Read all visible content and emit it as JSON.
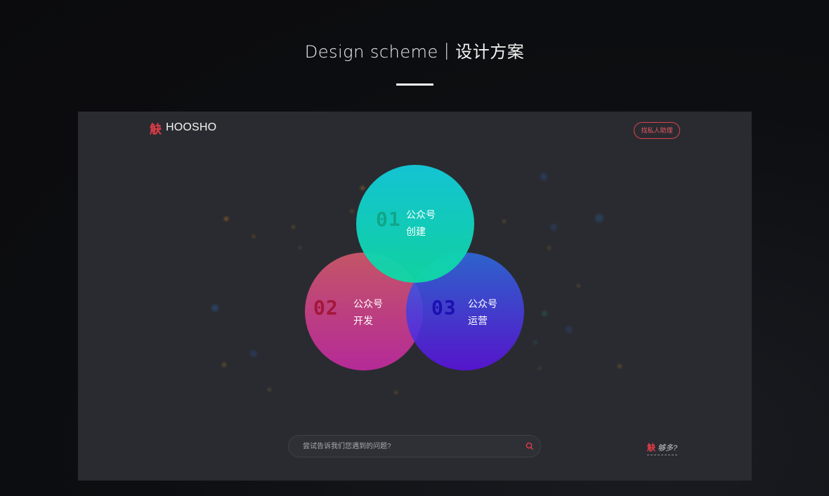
{
  "header": {
    "title": "Design scheme｜设计方案"
  },
  "mockup": {
    "logo_mark": "觖",
    "logo_text": "HOOSHO",
    "assistant_button": "找私人助理",
    "circles": [
      {
        "number": "01",
        "line1": "公众号",
        "line2": "创建"
      },
      {
        "number": "02",
        "line1": "公众号",
        "line2": "开发"
      },
      {
        "number": "03",
        "line1": "公众号",
        "line2": "运营"
      }
    ],
    "search": {
      "placeholder": "尝试告诉我们您遇到的问题?"
    },
    "footer_brand_mark": "觖",
    "footer_brand_text": "够多?"
  },
  "colors": {
    "accent_red": "#e23b48",
    "circle1": "#13c9d9",
    "circle2": "#c82aa6",
    "circle3": "#5b12e0"
  },
  "icons": {
    "search": "search-icon"
  }
}
